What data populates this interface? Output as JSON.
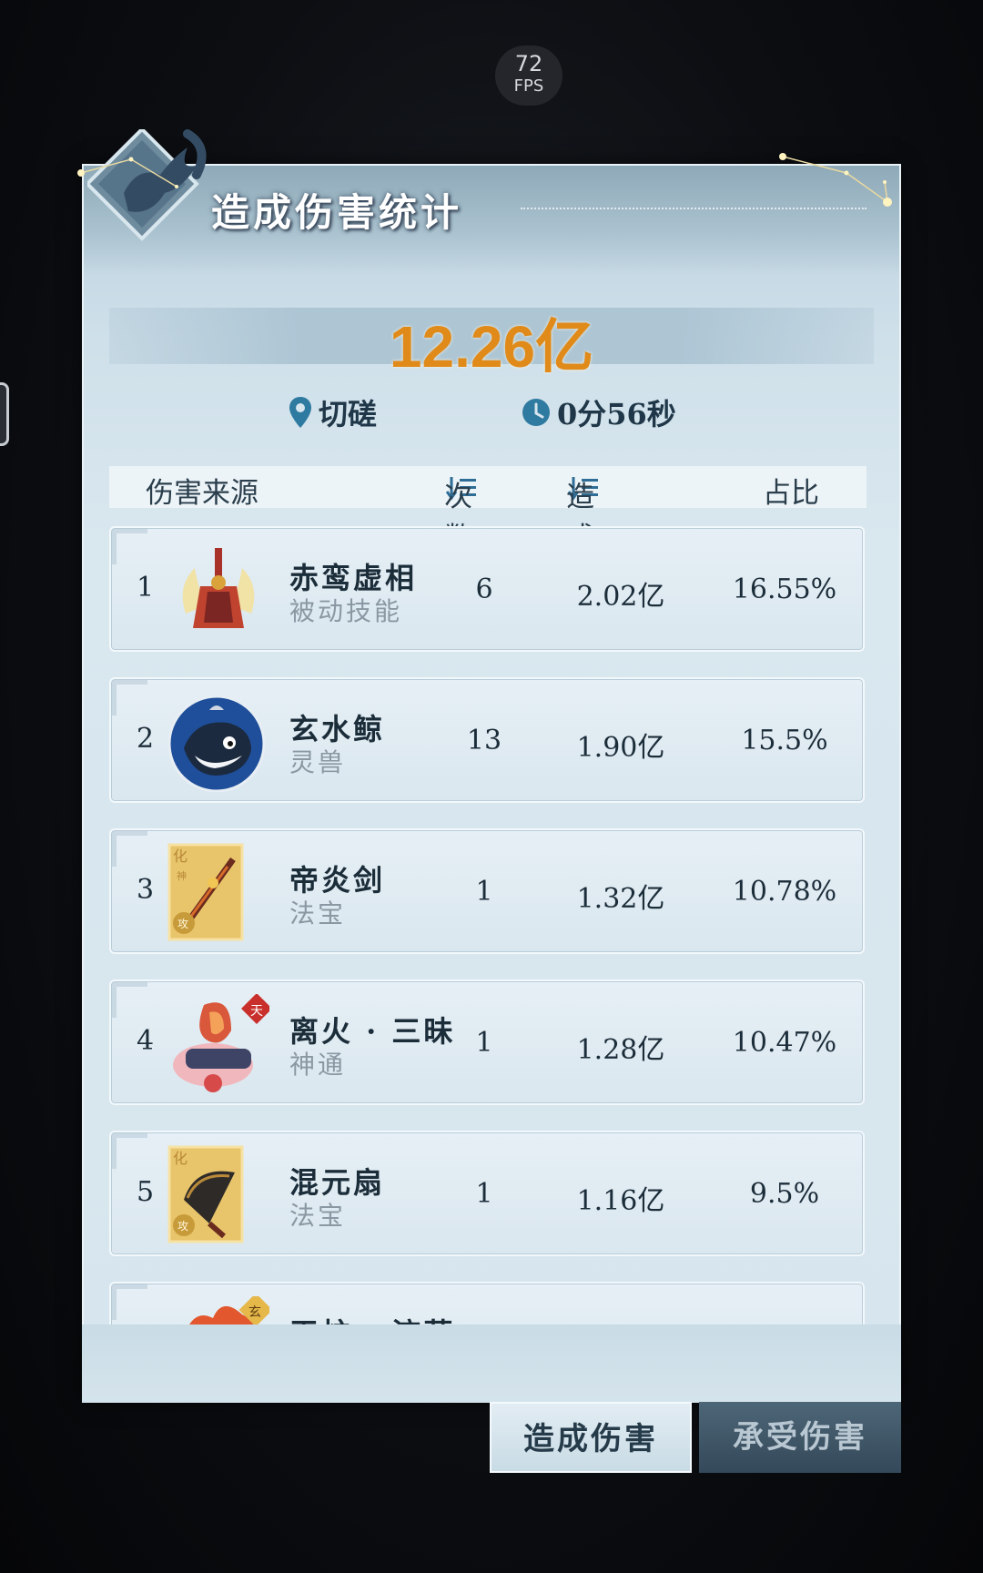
{
  "overlay": {
    "fps_value": "72",
    "fps_unit": "FPS"
  },
  "panel": {
    "title": "造成伤害统计",
    "total_damage": "12.26亿",
    "mode": "切磋",
    "duration": "0分56秒"
  },
  "table": {
    "headers": {
      "source": "伤害来源",
      "count": "次数",
      "damage": "造成伤害",
      "ratio": "占比"
    },
    "rows": [
      {
        "rank": "1",
        "name": "赤鸾虚相",
        "type": "被动技能",
        "count": "6",
        "damage": "2.02亿",
        "ratio": "16.55%",
        "icon": "phoenix-armor-icon"
      },
      {
        "rank": "2",
        "name": "玄水鲸",
        "type": "灵兽",
        "count": "13",
        "damage": "1.90亿",
        "ratio": "15.5%",
        "icon": "whale-beast-icon"
      },
      {
        "rank": "3",
        "name": "帝炎剑",
        "type": "法宝",
        "count": "1",
        "damage": "1.32亿",
        "ratio": "10.78%",
        "icon": "sword-treasure-icon",
        "badge_top": "化",
        "badge_mid": "神",
        "badge_corner": "攻"
      },
      {
        "rank": "4",
        "name": "离火 · 三昧",
        "type": "神通",
        "count": "1",
        "damage": "1.28亿",
        "ratio": "10.47%",
        "icon": "fire-scroll-icon",
        "badge_corner": "天"
      },
      {
        "rank": "5",
        "name": "混元扇",
        "type": "法宝",
        "count": "1",
        "damage": "1.16亿",
        "ratio": "9.5%",
        "icon": "fan-treasure-icon",
        "badge_top": "化",
        "badge_corner": "攻"
      },
      {
        "rank": "",
        "name": "天炉 · 流萤",
        "type": "",
        "count": "",
        "damage": "",
        "ratio": "",
        "icon": "flame-skill-icon",
        "badge_corner": "玄"
      }
    ]
  },
  "tabs": {
    "dealt": "造成伤害",
    "taken": "承受伤害"
  },
  "colors": {
    "total": "#e08a1a",
    "panel": "#d7e5ee",
    "active_tab": "#e2edf3",
    "inactive_tab": "#34495a"
  }
}
